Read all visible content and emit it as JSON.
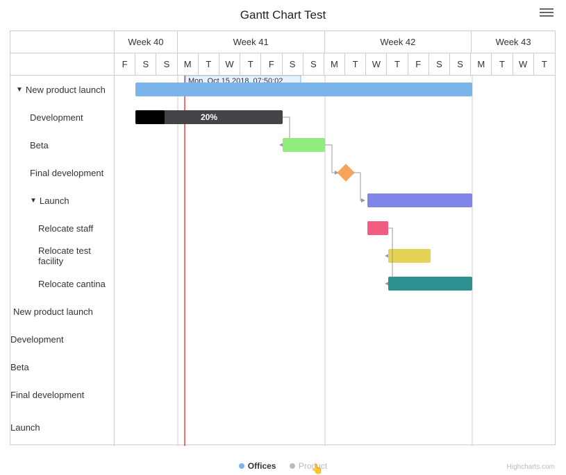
{
  "title": "Gantt Chart Test",
  "credit": "Highcharts.com",
  "header": {
    "weeks": [
      "Week 40",
      "Week 41",
      "Week 42",
      "Week 43"
    ],
    "days": [
      "F",
      "S",
      "S",
      "M",
      "T",
      "W",
      "T",
      "F",
      "S",
      "S",
      "M",
      "T",
      "W",
      "T",
      "F",
      "S",
      "S",
      "M",
      "T",
      "W",
      "T"
    ]
  },
  "rows": {
    "r0": "New product launch",
    "r1": "Development",
    "r2": "Beta",
    "r3": "Final development",
    "r4": "Launch",
    "r5": "Relocate staff",
    "r6": "Relocate test facility",
    "r7": "Relocate cantina",
    "r8": "New product launch",
    "r9": "Development",
    "r10": "Beta",
    "r11": "Final development",
    "r12": "Launch"
  },
  "progress_label": "20%",
  "tooltip_text": "Mon, Oct 15 2018, 07:50:02",
  "legend": {
    "offices": "Offices",
    "product": "Product"
  },
  "chart_data": {
    "type": "gantt",
    "x_axis": {
      "start_date": "2018-10-12",
      "days": [
        "2018-10-12",
        "2018-10-13",
        "2018-10-14",
        "2018-10-15",
        "2018-10-16",
        "2018-10-17",
        "2018-10-18",
        "2018-10-19",
        "2018-10-20",
        "2018-10-21",
        "2018-10-22",
        "2018-10-23",
        "2018-10-24",
        "2018-10-25",
        "2018-10-26",
        "2018-10-27",
        "2018-10-28",
        "2018-10-29",
        "2018-10-30",
        "2018-10-31",
        "2018-11-01"
      ],
      "week_groups": [
        {
          "label": "Week 40",
          "span_days": 3
        },
        {
          "label": "Week 41",
          "span_days": 7
        },
        {
          "label": "Week 42",
          "span_days": 7
        },
        {
          "label": "Week 43",
          "span_days": 4
        }
      ]
    },
    "current_time_marker": "2018-10-15T07:50:02",
    "series": [
      {
        "name": "Offices",
        "visible": true
      },
      {
        "name": "Product",
        "visible": false
      }
    ],
    "tasks": [
      {
        "name": "New product launch",
        "start": "2018-10-13",
        "end": "2018-10-29",
        "color": "#7cb5ec",
        "collapsible": true
      },
      {
        "name": "Development",
        "start": "2018-10-13",
        "end": "2018-10-20",
        "parent": "New product launch",
        "color": "#434348",
        "progress": 0.2
      },
      {
        "name": "Beta",
        "start": "2018-10-20",
        "end": "2018-10-22",
        "parent": "New product launch",
        "color": "#90ed7d",
        "depends_on": "Development"
      },
      {
        "name": "Final development",
        "date": "2018-10-23",
        "milestone": true,
        "parent": "New product launch",
        "color": "#f7a35c",
        "depends_on": "Beta"
      },
      {
        "name": "Launch",
        "start": "2018-10-24",
        "end": "2018-10-29",
        "parent": "New product launch",
        "color": "#8085e9",
        "collapsible": true,
        "depends_on": "Final development"
      },
      {
        "name": "Relocate staff",
        "start": "2018-10-24",
        "end": "2018-10-25",
        "parent": "Launch",
        "color": "#f15c80"
      },
      {
        "name": "Relocate test facility",
        "start": "2018-10-25",
        "end": "2018-10-27",
        "parent": "Launch",
        "color": "#e4d354",
        "depends_on": "Relocate staff"
      },
      {
        "name": "Relocate cantina",
        "start": "2018-10-25",
        "end": "2018-10-29",
        "parent": "Launch",
        "color": "#2b908f",
        "depends_on": "Relocate staff"
      }
    ]
  }
}
